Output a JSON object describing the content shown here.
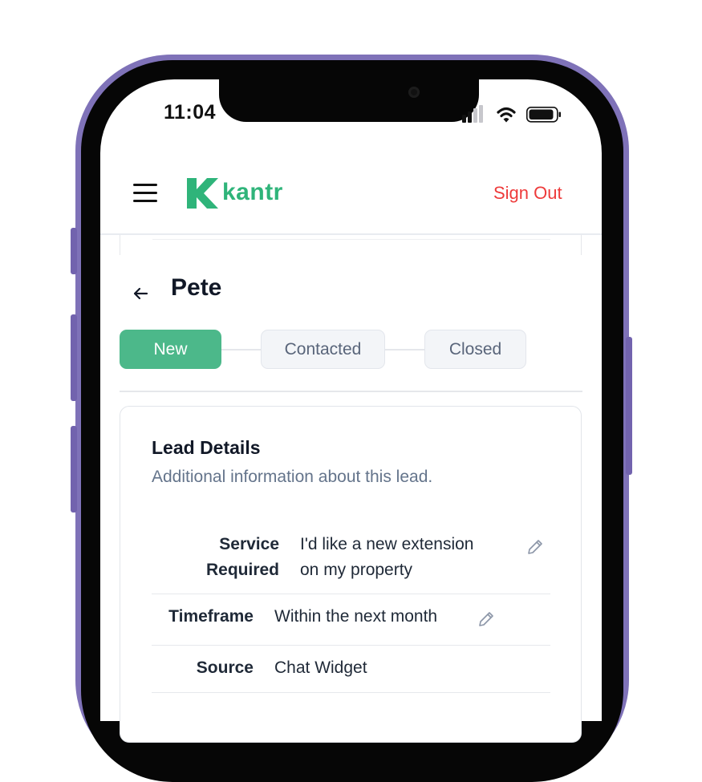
{
  "status_bar": {
    "time": "11:04"
  },
  "header": {
    "brand": "kantr",
    "sign_out_label": "Sign Out"
  },
  "lead": {
    "name": "Pete"
  },
  "stages": [
    {
      "label": "New",
      "active": true
    },
    {
      "label": "Contacted",
      "active": false
    },
    {
      "label": "Closed",
      "active": false
    }
  ],
  "details": {
    "title": "Lead Details",
    "subtitle": "Additional information about this lead.",
    "fields": [
      {
        "label_line1": "Service",
        "label_line2": "Required",
        "value_line1": "I'd like a new extension",
        "value_line2": "on my property"
      },
      {
        "label": "Timeframe",
        "value": "Within the next month"
      },
      {
        "label": "Source",
        "value": "Chat Widget"
      }
    ]
  },
  "colors": {
    "frame": "#7f72b8",
    "brand": "#2fb47a",
    "sign_out": "#ee3b3b",
    "stage_active": "#4cb88a",
    "subtitle": "#64748b"
  },
  "icons": [
    "menu-icon",
    "kantr-logo-icon",
    "back-arrow-icon",
    "edit-pencil-icon",
    "signal-icon",
    "wifi-icon",
    "battery-icon"
  ]
}
